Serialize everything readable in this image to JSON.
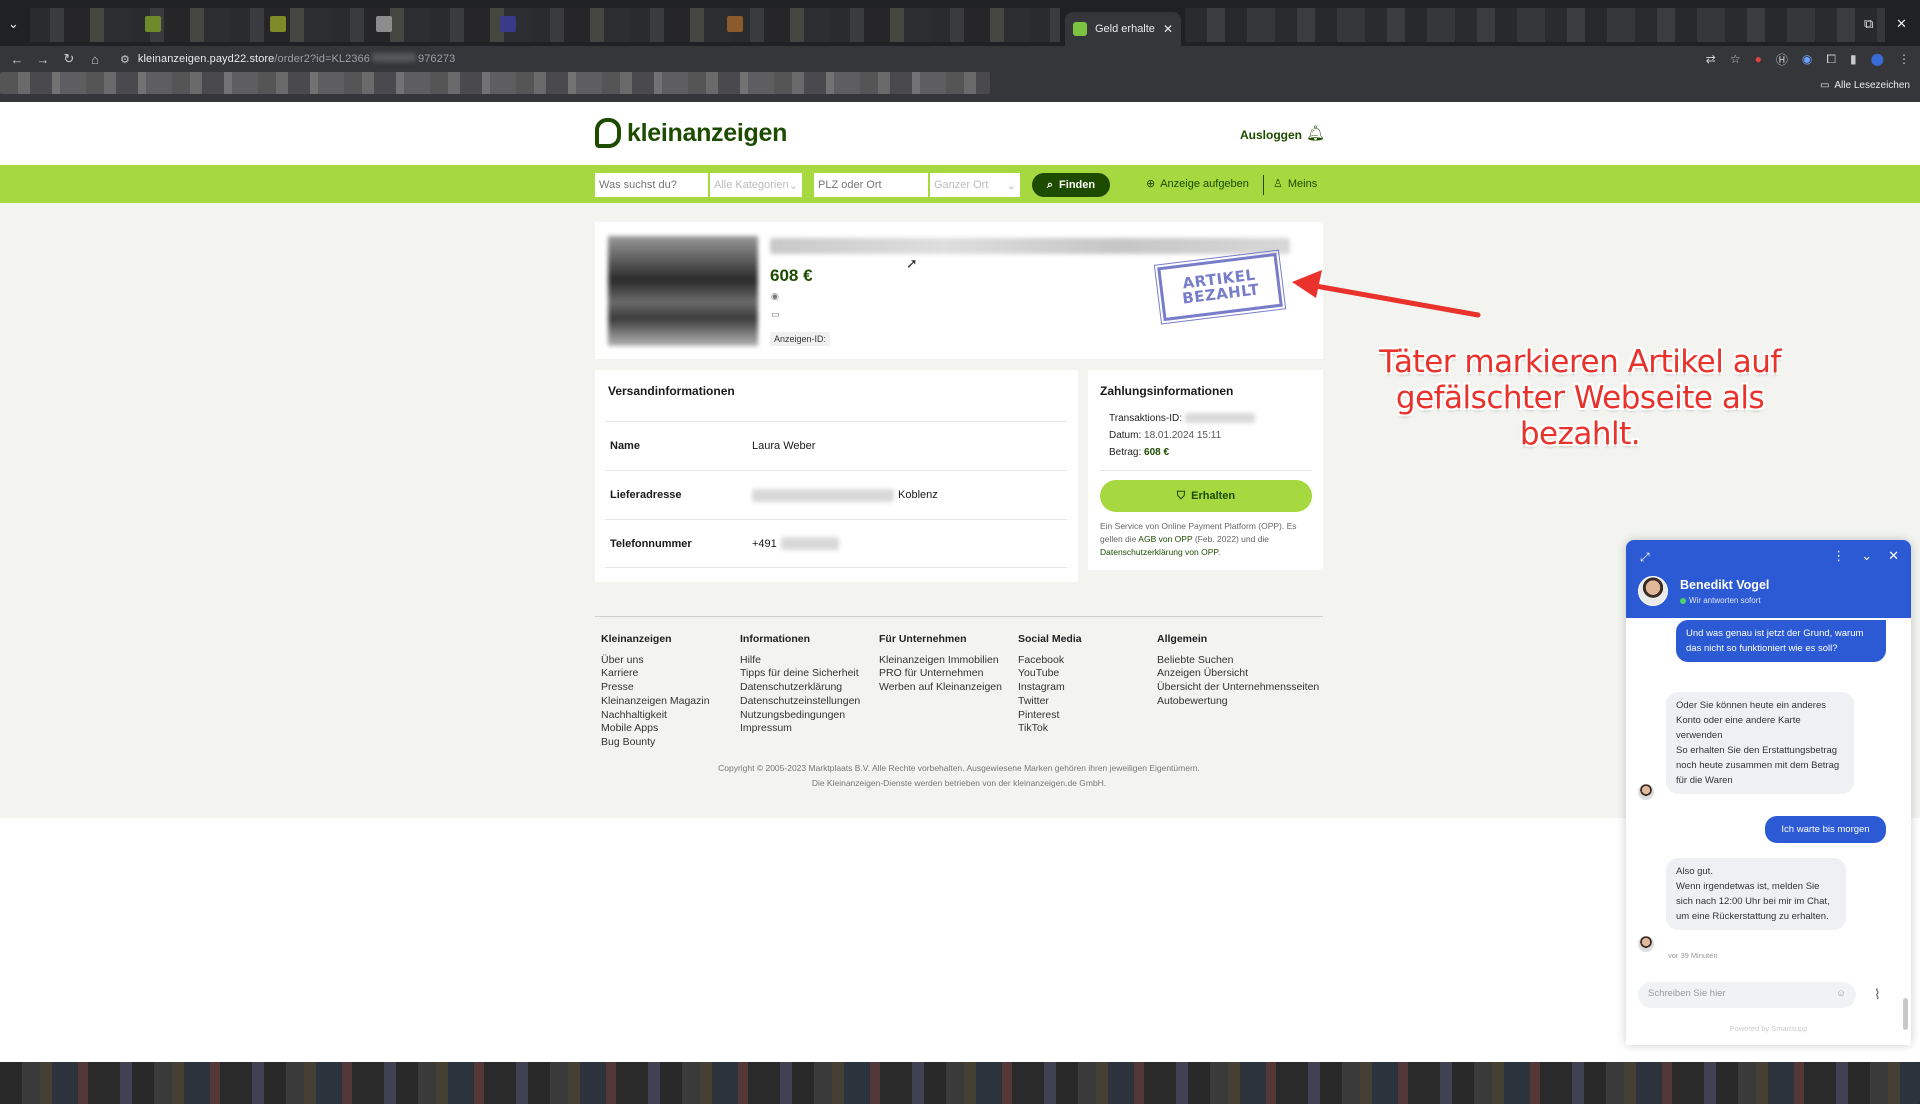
{
  "browser": {
    "active_tab_title": "Geld erhalten |",
    "url_visible_start": "kleinanzeigen.payd22.store",
    "url_visible_mid": "/order2?id=KL2366",
    "url_visible_end": "976273",
    "bookmarks_folder": "Alle Lesezeichen"
  },
  "site": {
    "logo_text": "kleinanzeigen",
    "logout": "Ausloggen",
    "search": {
      "query_placeholder": "Was suchst du?",
      "category": "Alle Kategorien",
      "location_placeholder": "PLZ oder Ort",
      "radius": "Ganzer Ort",
      "find_button": "Finden",
      "post_ad": "Anzeige aufgeben",
      "mine": "Meins"
    }
  },
  "item": {
    "price": "608 €",
    "ad_id_label": "Anzeigen-ID:",
    "stamp_line1": "ARTIKEL",
    "stamp_line2": "BEZAHLT"
  },
  "shipping": {
    "heading": "Versandinformationen",
    "rows": [
      {
        "label": "Name",
        "value": "Laura Weber"
      },
      {
        "label": "Lieferadresse",
        "value": "Koblenz"
      },
      {
        "label": "Telefonnummer",
        "value": "+491"
      }
    ]
  },
  "payment": {
    "heading": "Zahlungsinformationen",
    "transaction_label": "Transaktions-ID:",
    "date_label": "Datum:",
    "date_value": "18.01.2024 15:11",
    "amount_label": "Betrag:",
    "amount_value": "608 €",
    "receive_button": "Erhalten",
    "note_1": "Ein Service von Online Payment Platform (OPP). Es gellen die ",
    "note_agb": "AGB von OPP",
    "note_2": " (Feb. 2022) und die ",
    "note_privacy": "Datenschutzerklärung von OPP",
    "note_3": "."
  },
  "footer": {
    "columns": [
      {
        "heading": "Kleinanzeigen",
        "links": [
          "Über uns",
          "Karriere",
          "Presse",
          "Kleinanzeigen Magazin",
          "Nachhaltigkeit",
          "Mobile Apps",
          "Bug Bounty"
        ]
      },
      {
        "heading": "Informationen",
        "links": [
          "Hilfe",
          "Tipps für deine Sicherheit",
          "Datenschutzerklärung",
          "Datenschutzeinstellungen",
          "Nutzungsbedingungen",
          "Impressum"
        ]
      },
      {
        "heading": "Für Unternehmen",
        "links": [
          "Kleinanzeigen Immobilien",
          "PRO für Unternehmen",
          "Werben auf Kleinanzeigen"
        ]
      },
      {
        "heading": "Social Media",
        "links": [
          "Facebook",
          "YouTube",
          "Instagram",
          "Twitter",
          "Pinterest",
          "TikTok"
        ]
      },
      {
        "heading": "Allgemein",
        "links": [
          "Beliebte Suchen",
          "Anzeigen Übersicht",
          "Übersicht der Unternehmensseiten",
          "Autobewertung"
        ]
      }
    ],
    "copyright_1": "Copyright © 2005-2023 Marktplaats B.V. Alle Rechte vorbehalten. Ausgewiesene Marken gehören ihren jeweiligen Eigentümern.",
    "copyright_2": "Die Kleinanzeigen-Dienste werden betrieben von der kleinanzeigen.de GmbH."
  },
  "annotation": {
    "text": "Täter markieren Artikel auf gefälschter Webseite als bezahlt."
  },
  "chat": {
    "agent_name": "Benedikt Vogel",
    "status": "Wir antworten sofort",
    "messages": [
      {
        "from": "user",
        "text": "Und was genau ist jetzt der Grund, warum das nicht so funktioniert wie es soll?"
      },
      {
        "from": "agent",
        "text": "Oder Sie können heute ein anderes Konto oder eine andere Karte verwenden\nSo erhalten Sie den Erstattungsbetrag noch heute zusammen mit dem Betrag für die Waren"
      },
      {
        "from": "user",
        "text": "Ich warte bis morgen"
      },
      {
        "from": "agent",
        "text": "Also gut.\nWenn irgendetwas ist, melden Sie sich nach 12:00 Uhr bei mir im Chat, um eine Rückerstattung zu erhalten."
      }
    ],
    "last_time": "vor 39 Minuten",
    "input_placeholder": "Schreiben Sie hier",
    "powered": "Powered by Smartsupp"
  },
  "colors": {
    "brand_dark": "#1d4b00",
    "brand_lime": "#a6d83f",
    "chat_blue": "#2c5ad4",
    "annotation_red": "#e8322b",
    "stamp_purple": "#6a6fc5"
  }
}
